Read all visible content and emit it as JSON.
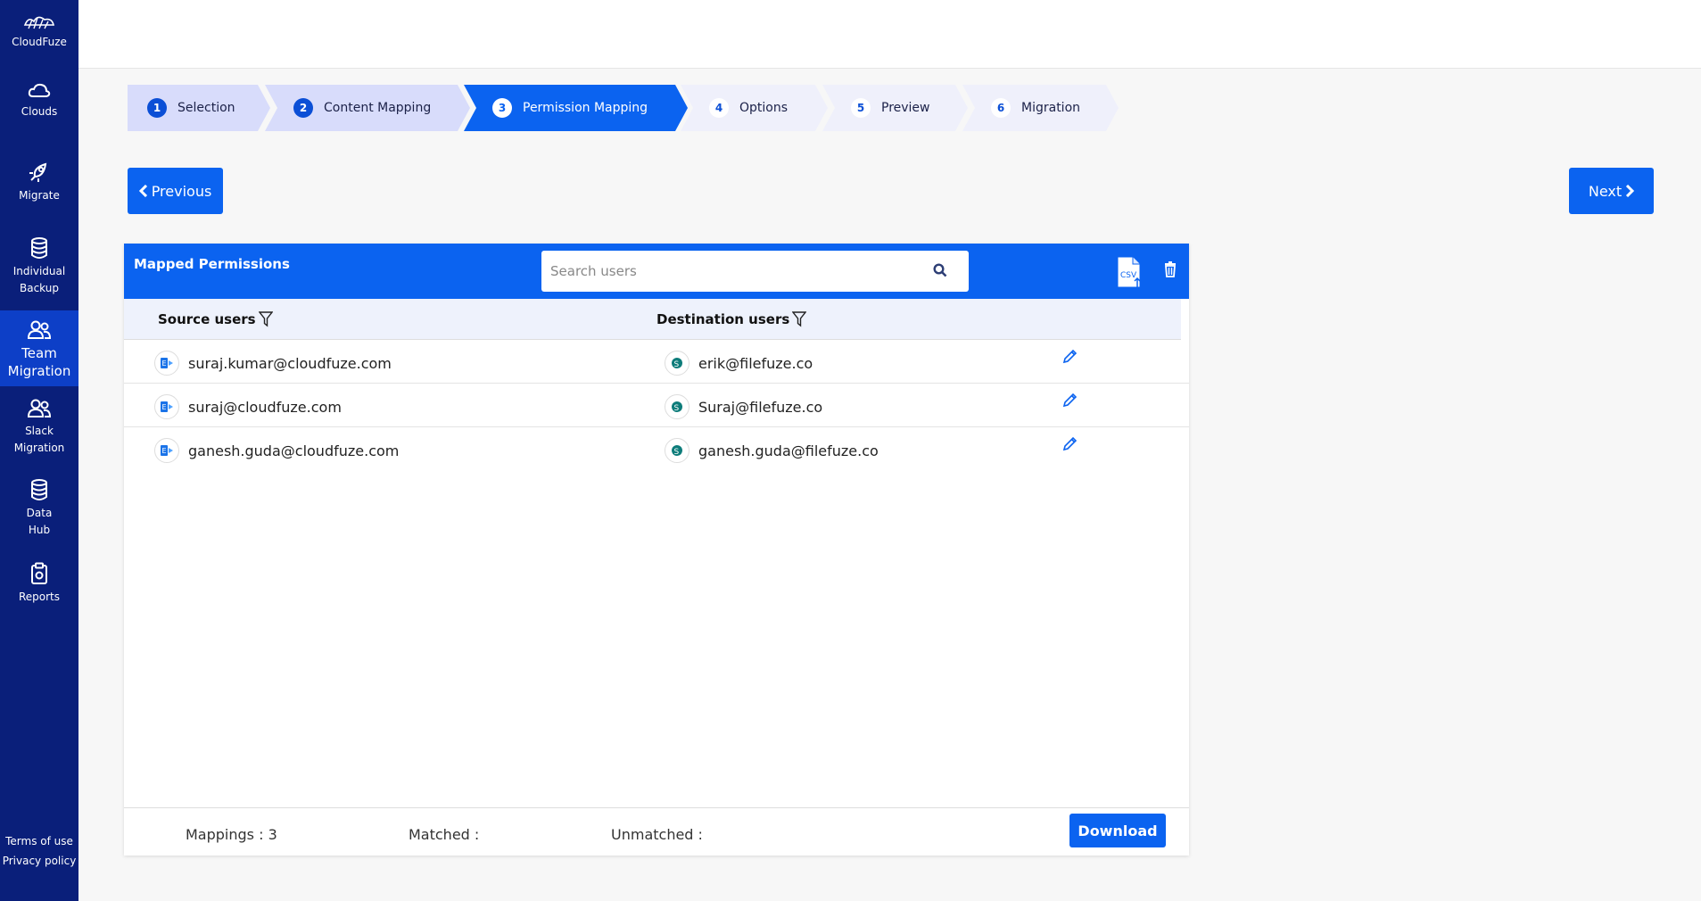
{
  "app": {
    "brand": "CloudFuze"
  },
  "sidebar": {
    "items": [
      {
        "label": "Clouds",
        "icon": "cloud-icon"
      },
      {
        "label": "Migrate",
        "icon": "rocket-icon"
      },
      {
        "label": "Individual\nBackup",
        "icon": "database-icon"
      },
      {
        "label": "Team\nMigration",
        "icon": "users-icon",
        "active": true
      },
      {
        "label": "Slack\nMigration",
        "icon": "users-icon"
      },
      {
        "label": "Data\nHub",
        "icon": "database-icon"
      },
      {
        "label": "Reports",
        "icon": "clipboard-icon"
      }
    ],
    "footer_links": [
      "Terms of use",
      "Privacy policy"
    ]
  },
  "stepper": {
    "steps": [
      {
        "num": "1",
        "label": "Selection",
        "state": "done"
      },
      {
        "num": "2",
        "label": "Content Mapping",
        "state": "done"
      },
      {
        "num": "3",
        "label": "Permission Mapping",
        "state": "current"
      },
      {
        "num": "4",
        "label": "Options",
        "state": "todo"
      },
      {
        "num": "5",
        "label": "Preview",
        "state": "todo"
      },
      {
        "num": "6",
        "label": "Migration",
        "state": "todo"
      }
    ]
  },
  "nav": {
    "previous": "Previous",
    "next": "Next"
  },
  "card": {
    "title": "Mapped Permissions",
    "search_placeholder": "Search users",
    "columns": {
      "source": "Source users",
      "destination": "Destination users"
    },
    "rows": [
      {
        "source": "suraj.kumar@cloudfuze.com",
        "destination": "erik@filefuze.co"
      },
      {
        "source": "suraj@cloudfuze.com",
        "destination": "Suraj@filefuze.co"
      },
      {
        "source": "ganesh.guda@cloudfuze.com",
        "destination": "ganesh.guda@filefuze.co"
      }
    ],
    "footer": {
      "mappings": "Mappings : 3",
      "matched": "Matched :",
      "unmatched": "Unmatched :",
      "download": "Download"
    }
  },
  "colors": {
    "sidebar": "#0a1f7a",
    "accent": "#0b63f0",
    "active_nav": "#0d3fc7"
  }
}
